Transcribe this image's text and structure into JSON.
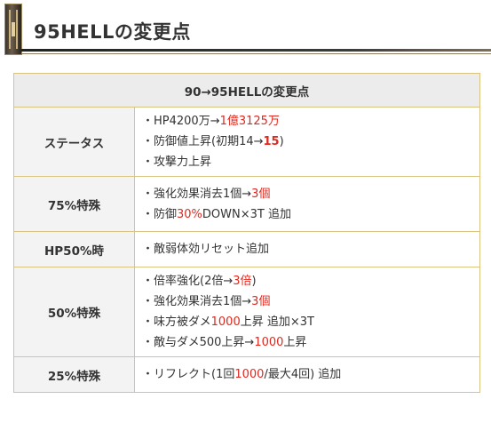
{
  "header": {
    "title": "95HELLの変更点"
  },
  "table": {
    "heading": "90→95HELLの変更点",
    "rows": [
      {
        "label": "ステータス",
        "items": [
          [
            {
              "t": "・HP4200万→"
            },
            {
              "t": "1億3125万",
              "s": "red"
            }
          ],
          [
            {
              "t": "・防御値上昇(初期14→"
            },
            {
              "t": "15",
              "s": "red-bold"
            },
            {
              "t": ")"
            }
          ],
          [
            {
              "t": "・攻撃力上昇"
            }
          ]
        ]
      },
      {
        "label": "75%特殊",
        "items": [
          [
            {
              "t": "・強化効果消去1個→"
            },
            {
              "t": "3個",
              "s": "red"
            }
          ],
          [
            {
              "t": "・防御"
            },
            {
              "t": "30%",
              "s": "red"
            },
            {
              "t": "DOWN×3T 追加"
            }
          ]
        ]
      },
      {
        "label": "HP50%時",
        "items": [
          [
            {
              "t": "・敵弱体効リセット追加"
            }
          ]
        ]
      },
      {
        "label": "50%特殊",
        "items": [
          [
            {
              "t": "・倍率強化(2倍→"
            },
            {
              "t": "3倍",
              "s": "red"
            },
            {
              "t": ")"
            }
          ],
          [
            {
              "t": "・強化効果消去1個→"
            },
            {
              "t": "3個",
              "s": "red"
            }
          ],
          [
            {
              "t": "・味方被ダメ"
            },
            {
              "t": "1000",
              "s": "red"
            },
            {
              "t": "上昇 追加×3T"
            }
          ],
          [
            {
              "t": "・敵与ダメ500上昇→"
            },
            {
              "t": "1000",
              "s": "red"
            },
            {
              "t": "上昇"
            }
          ]
        ]
      },
      {
        "label": "25%特殊",
        "items": [
          [
            {
              "t": "・リフレクト(1回"
            },
            {
              "t": "1000",
              "s": "red"
            },
            {
              "t": "/最大4回) 追加"
            }
          ]
        ]
      }
    ]
  },
  "colors": {
    "accent_red": "#e0281e",
    "border_gold": "#d9c483",
    "label_bg": "#f3f3f3",
    "head_bg": "#ececec"
  }
}
